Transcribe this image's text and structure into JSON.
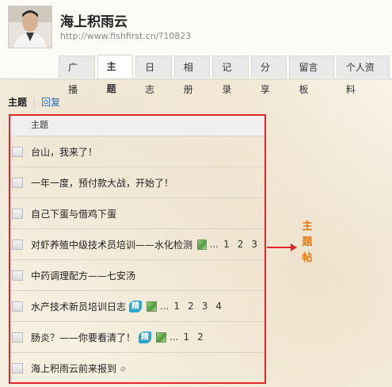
{
  "profile": {
    "name": "海上积雨云",
    "url": "http://www.fishfirst.cn/?10823"
  },
  "nav": {
    "tabs": [
      {
        "label": "广播",
        "active": false
      },
      {
        "label": "主题",
        "active": true
      },
      {
        "label": "日志",
        "active": false
      },
      {
        "label": "相册",
        "active": false
      },
      {
        "label": "记录",
        "active": false
      },
      {
        "label": "分享",
        "active": false
      },
      {
        "label": "留言板",
        "active": false
      },
      {
        "label": "个人资料",
        "active": false
      }
    ]
  },
  "subtabs": {
    "topics_label": "主题",
    "replies_label": "回复"
  },
  "list": {
    "header": "主题",
    "rows": [
      {
        "title": "台山，我来了！"
      },
      {
        "title": "一年一度，预付款大战，开始了！"
      },
      {
        "title": "自己下蛋与借鸡下蛋"
      },
      {
        "title": "对虾养殖中级技术员培训——水化检测",
        "image": true,
        "dots": "...",
        "pages": [
          "1",
          "2",
          "3"
        ]
      },
      {
        "title": "中药调理配方——七安汤"
      },
      {
        "title": "水产技术新员培训日志",
        "badge": "精",
        "image": true,
        "dots": "...",
        "pages": [
          "1",
          "2",
          "3",
          "4"
        ]
      },
      {
        "title": "肠炎？——你要看清了！",
        "badge": "精",
        "image": true,
        "dots": "...",
        "pages": [
          "1",
          "2"
        ]
      },
      {
        "title": "海上积雨云前来报到",
        "attachment": true
      }
    ]
  },
  "annotation": {
    "chars": [
      "主",
      "题",
      "帖"
    ],
    "color": "#e07a12",
    "box_color": "#e0252b"
  }
}
